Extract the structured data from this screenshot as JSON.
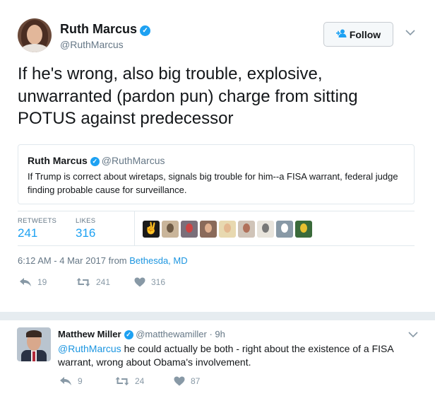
{
  "tweet": {
    "author_name": "Ruth Marcus",
    "author_handle": "@RuthMarcus",
    "verified_glyph": "✓",
    "follow_label": "Follow",
    "follow_icon": "+",
    "text": "If he's wrong, also big trouble, explosive, unwarranted (pardon pun) charge from sitting POTUS against predecessor",
    "quoted": {
      "author_name": "Ruth Marcus",
      "author_handle": "@RuthMarcus",
      "text": "If Trump is correct about wiretaps, signals big trouble for him--a FISA warrant, federal judge finding probable cause for surveillance."
    },
    "stats": {
      "retweets_label": "RETWEETS",
      "retweets_value": "241",
      "likes_label": "LIKES",
      "likes_value": "316"
    },
    "likers": [
      {
        "name": "peace-hand-avatar",
        "bg": "#1a1a1a",
        "fg": "#ffffff",
        "glyph": "✌"
      },
      {
        "name": "cat-avatar",
        "bg": "#c9b59a",
        "fg": "#6d5a45",
        "glyph": ""
      },
      {
        "name": "group-avatar",
        "bg": "#7a6f7a",
        "fg": "#c44",
        "glyph": ""
      },
      {
        "name": "woman-avatar-1",
        "bg": "#8a6a5a",
        "fg": "#e0b090",
        "glyph": ""
      },
      {
        "name": "woman-avatar-2",
        "bg": "#e8d9b0",
        "fg": "#e4b890",
        "glyph": ""
      },
      {
        "name": "woman-avatar-3",
        "bg": "#d0c4b8",
        "fg": "#b0705a",
        "glyph": ""
      },
      {
        "name": "text-card-avatar",
        "bg": "#e8e4dc",
        "fg": "#777",
        "glyph": ""
      },
      {
        "name": "default-egg-avatar",
        "bg": "#8899a6",
        "fg": "#ffffff",
        "glyph": ""
      },
      {
        "name": "comic-avatar",
        "bg": "#3a6a3a",
        "fg": "#e8c030",
        "glyph": ""
      }
    ],
    "timestamp": "6:12 AM - 4 Mar 2017 from",
    "location": "Bethesda, MD",
    "actions": {
      "reply_count": "19",
      "retweet_count": "241",
      "like_count": "316"
    }
  },
  "reply": {
    "author_name": "Matthew Miller",
    "author_handle": "@matthewamiller",
    "dot": "·",
    "time": "9h",
    "mention": "@RuthMarcus",
    "text": " he could actually be both - right about the existence of a FISA warrant, wrong about Obama's involvement.",
    "actions": {
      "reply_count": "9",
      "retweet_count": "24",
      "like_count": "87"
    }
  },
  "colors": {
    "accent": "#1da1f2",
    "link": "#1b95e0",
    "muted": "#657786",
    "icon": "#8899a6",
    "separator": "#e6ecf0"
  },
  "icons": [
    "verified-badge-icon",
    "add-user-icon",
    "chevron-down-icon",
    "reply-icon",
    "retweet-icon",
    "heart-icon"
  ]
}
